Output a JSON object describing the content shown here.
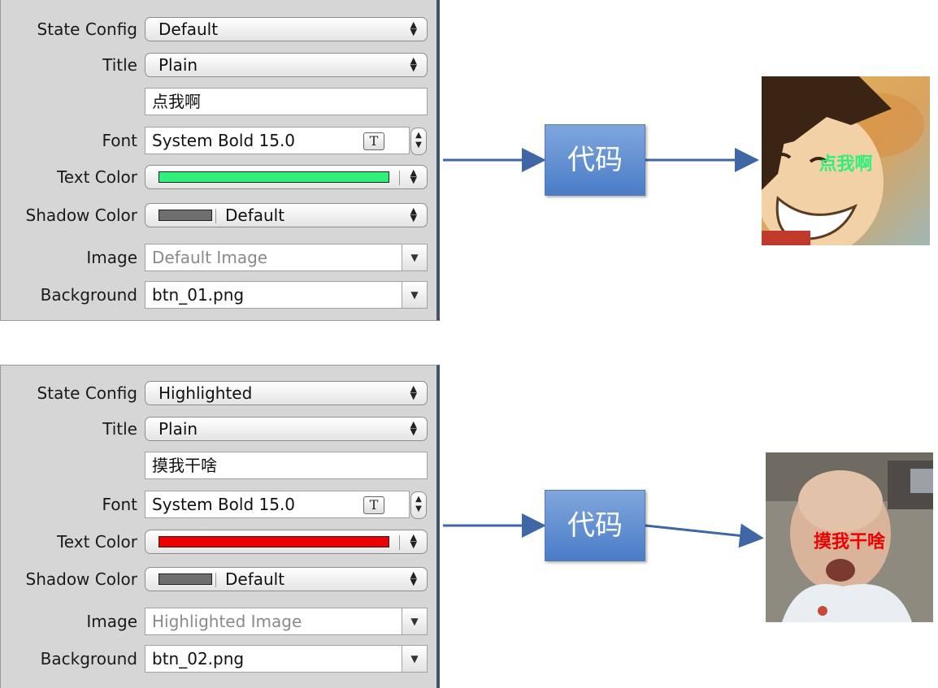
{
  "top": {
    "state_config_label": "State Config",
    "state_config_value": "Default",
    "title_label": "Title",
    "title_value": "Plain",
    "title_text": "点我啊",
    "font_label": "Font",
    "font_value": "System Bold 15.0",
    "text_color_label": "Text Color",
    "text_color": "#2ef07a",
    "shadow_color_label": "Shadow Color",
    "shadow_color_value": "Default",
    "shadow_color": "#6e6e6e",
    "image_label": "Image",
    "image_placeholder": "Default Image",
    "background_label": "Background",
    "background_value": "btn_01.png"
  },
  "bottom": {
    "state_config_label": "State Config",
    "state_config_value": "Highlighted",
    "title_label": "Title",
    "title_value": "Plain",
    "title_text": "摸我干啥",
    "font_label": "Font",
    "font_value": "System Bold 15.0",
    "text_color_label": "Text Color",
    "text_color": "#ee0000",
    "shadow_color_label": "Shadow Color",
    "shadow_color_value": "Default",
    "shadow_color": "#6e6e6e",
    "image_label": "Image",
    "image_placeholder": "Highlighted Image",
    "background_label": "Background",
    "background_value": "btn_02.png"
  },
  "flow": {
    "code_label_top": "代码",
    "code_label_bottom": "代码",
    "arrow_color": "#3f67a6"
  },
  "preview": {
    "top_caption": "点我啊",
    "top_caption_color": "#2ef07a",
    "bottom_caption": "摸我干啥",
    "bottom_caption_color": "#ee0000"
  }
}
